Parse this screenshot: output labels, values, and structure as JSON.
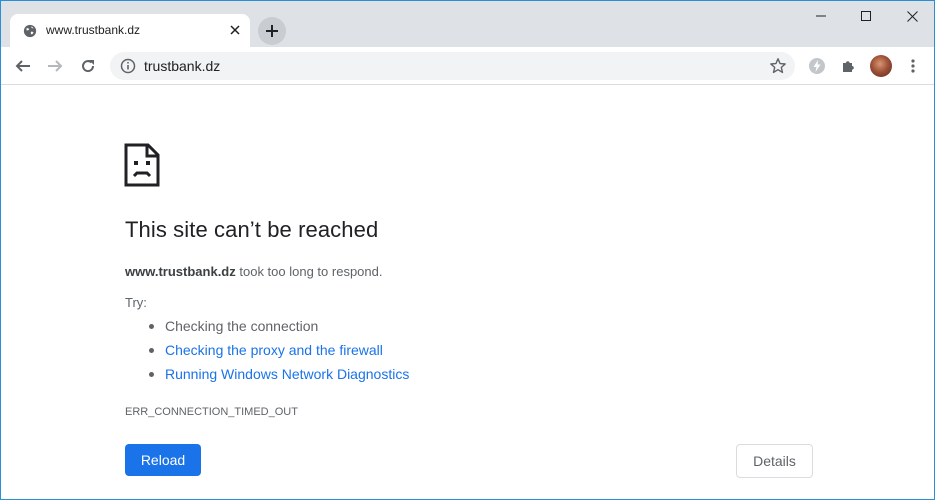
{
  "tab": {
    "title": "www.trustbank.dz",
    "favicon": "globe-icon",
    "close_icon": "close-icon"
  },
  "newtab": {
    "icon": "plus-icon"
  },
  "window_controls": {
    "minimize": "minimize-icon",
    "maximize": "maximize-icon",
    "close": "close-icon"
  },
  "toolbar": {
    "back_icon": "back-arrow-icon",
    "forward_icon": "forward-arrow-icon",
    "reload_icon": "reload-icon",
    "url": "trustbank.dz",
    "site_info_icon": "info-icon",
    "bookmark_icon": "star-icon",
    "extensions": [
      "lightning-extension-icon",
      "puzzle-icon"
    ],
    "menu_icon": "kebab-menu-icon"
  },
  "error": {
    "icon": "sad-page-icon",
    "title": "This site can’t be reached",
    "host": "www.trustbank.dz",
    "message": "took too long to respond.",
    "try_label": "Try:",
    "suggestions": [
      {
        "text": "Checking the connection",
        "link": false
      },
      {
        "text": "Checking the proxy and the firewall",
        "link": true
      },
      {
        "text": "Running Windows Network Diagnostics",
        "link": true
      }
    ],
    "code": "ERR_CONNECTION_TIMED_OUT",
    "reload_label": "Reload",
    "details_label": "Details"
  },
  "colors": {
    "link": "#1a73e8",
    "primary_button": "#1a73e8",
    "tabstrip": "#dee1e6",
    "frame_border": "#2b8fd6"
  }
}
